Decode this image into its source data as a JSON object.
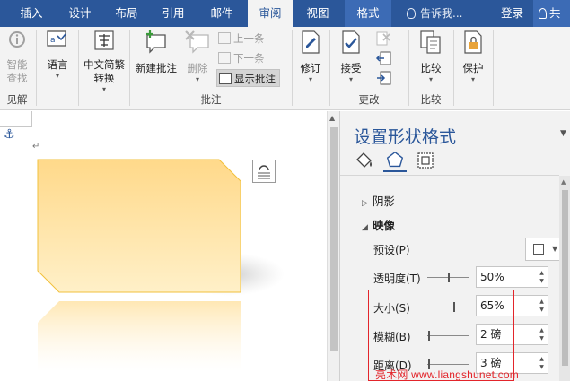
{
  "tabs": [
    {
      "label": "插入",
      "active": false
    },
    {
      "label": "设计",
      "active": false
    },
    {
      "label": "布局",
      "active": false
    },
    {
      "label": "引用",
      "active": false
    },
    {
      "label": "邮件",
      "active": false
    },
    {
      "label": "审阅",
      "active": true
    },
    {
      "label": "视图",
      "active": false
    },
    {
      "label": "格式",
      "active": false
    }
  ],
  "tell_me": "告诉我...",
  "login": "登录",
  "share": "共",
  "ribbon": {
    "insights": {
      "line1": "智能",
      "line2": "查找",
      "group": "见解"
    },
    "language": {
      "label": "语言"
    },
    "chinese_convert": {
      "line1": "中文简繁",
      "line2": "转换"
    },
    "comments": {
      "new": "新建批注",
      "delete": "删除",
      "previous": "上一条",
      "next": "下一条",
      "show": "显示批注",
      "group": "批注"
    },
    "tracking": {
      "label": "修订"
    },
    "changes": {
      "accept": "接受",
      "group": "更改"
    },
    "compare": {
      "label": "比较",
      "group": "比较"
    },
    "protect": {
      "label": "保护"
    }
  },
  "pane": {
    "title": "设置形状格式",
    "sections": {
      "shadow": "阴影",
      "reflection": "映像"
    },
    "rows": {
      "preset": "预设(P)",
      "transparency": {
        "label": "透明度(T)",
        "value": "50%",
        "slider": 0.5
      },
      "size": {
        "label": "大小(S)",
        "value": "65%",
        "slider": 0.65
      },
      "blur": {
        "label": "模糊(B)",
        "value": "2 磅",
        "slider": 0.02
      },
      "distance": {
        "label": "距离(D)",
        "value": "3 磅",
        "slider": 0.03
      }
    }
  },
  "watermark": "亮术网 www.liangshunet.com",
  "colors": {
    "accent": "#2b579a",
    "shape_fill": "#ffd98a",
    "shape_border": "#f2c13c",
    "highlight": "#e3252b"
  }
}
